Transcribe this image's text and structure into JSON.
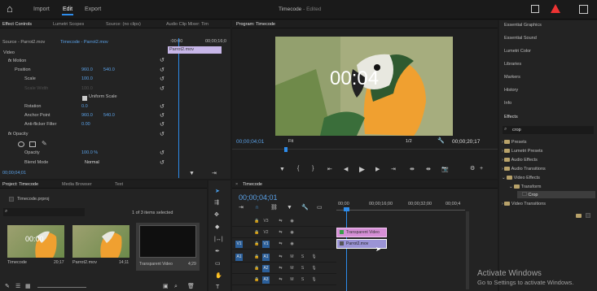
{
  "topbar": {
    "home": "⌂",
    "tabs": [
      "Import",
      "Edit",
      "Export"
    ],
    "active_tab": 1,
    "title": "Timecode",
    "subtitle": "- Edited"
  },
  "effect_controls": {
    "tabs": [
      "Effect Controls",
      "Lumetri Scopes",
      "Source: (no clips)",
      "Audio Clip Mixer: Tim"
    ],
    "source_label": "Source - Parrot2.mov",
    "clip_label": "Timecode - Parrot2.mov",
    "ruler_start": ":00:00",
    "ruler_end": "00;00;16;0",
    "clip_chip": "Parrot2.mov",
    "section_video": "Video",
    "motion": "Motion",
    "position": {
      "label": "Position",
      "x": "960.0",
      "y": "540.0"
    },
    "scale": {
      "label": "Scale",
      "v": "100.0"
    },
    "scale_width": {
      "label": "Scale Width",
      "v": "100.0"
    },
    "uniform": "Uniform Scale",
    "rotation": {
      "label": "Rotation",
      "v": "0.0"
    },
    "anchor": {
      "label": "Anchor Point",
      "x": "960.0",
      "y": "540.0"
    },
    "antiflicker": {
      "label": "Anti-flicker Filter",
      "v": "0.00"
    },
    "opacity": "Opacity",
    "opacity_val": {
      "label": "Opacity",
      "v": "100.0 %"
    },
    "blend": {
      "label": "Blend Mode",
      "v": "Normal"
    },
    "timecode": "00;00;04;01"
  },
  "program": {
    "title": "Program: Timecode",
    "overlay_tc": "00:04",
    "current_tc": "00;00;04;01",
    "fit": "Fit",
    "res": "1/2",
    "duration": "00;00;20;17"
  },
  "project": {
    "tabs": [
      "Project: Timecode",
      "Media Browser",
      "Text"
    ],
    "file": "Timecode.prproj",
    "selected": "1 of 3 items selected",
    "items": [
      {
        "name": "Timecode",
        "dur": "20;17",
        "tc": "00:00"
      },
      {
        "name": "Parrot2.mov",
        "dur": "14;11",
        "tc": ""
      },
      {
        "name": "Transparent Video",
        "dur": "4;29",
        "tc": ""
      }
    ]
  },
  "timeline": {
    "title": "Timecode",
    "tc": "00;00;04;01",
    "ruler": [
      "00;00",
      "00;00;16;00",
      "00;00;32;00",
      "00;00;4"
    ],
    "v_tracks": [
      "V3",
      "V2",
      "V1"
    ],
    "a_tracks": [
      "A1",
      "A2",
      "A3"
    ],
    "src_v": "V1",
    "src_a": "A1",
    "clips": [
      {
        "name": "Transparent Video",
        "color": "#d68fd6"
      },
      {
        "name": "Parrot2.mov",
        "color": "#9b94d6"
      }
    ]
  },
  "right_panels": {
    "items": [
      "Essential Graphics",
      "Essential Sound",
      "Lumetri Color",
      "Libraries",
      "Markers",
      "History",
      "Info",
      "Effects"
    ],
    "search": "crop",
    "tree": [
      "Presets",
      "Lumetri Presets",
      "Audio Effects",
      "Audio Transitions",
      "Video Effects",
      "Transform",
      "Crop",
      "Video Transitions"
    ]
  },
  "watermark": {
    "line1": "Activate Windows",
    "line2": "Go to Settings to activate Windows."
  },
  "colors": {
    "accent": "#2d8ceb",
    "clip_pink": "#d68fd6",
    "clip_purple": "#9b94d6"
  }
}
